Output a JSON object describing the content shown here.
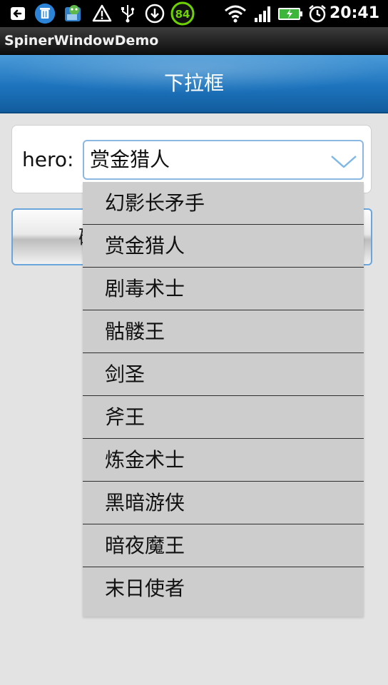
{
  "status_bar": {
    "time": "20:41",
    "battery_badge": "84",
    "icons": [
      "back-arrow-icon",
      "trash-icon",
      "app-icon",
      "warning-icon",
      "usb-icon",
      "download-icon",
      "badge-84-icon",
      "wifi-icon",
      "signal-icon",
      "battery-icon",
      "alarm-icon"
    ]
  },
  "app": {
    "title": "SpinerWindowDemo"
  },
  "header": {
    "title": "下拉框"
  },
  "form": {
    "hero_label": "hero:",
    "selected_value": "赏金猎人"
  },
  "confirm_button": {
    "label": "硊"
  },
  "dropdown": {
    "items": [
      {
        "label": "幻影长矛手"
      },
      {
        "label": "赏金猎人"
      },
      {
        "label": "剧毒术士"
      },
      {
        "label": "骷髅王"
      },
      {
        "label": "剑圣"
      },
      {
        "label": "斧王"
      },
      {
        "label": "炼金术士"
      },
      {
        "label": "黑暗游侠"
      },
      {
        "label": "暗夜魔王"
      },
      {
        "label": "末日使者"
      }
    ]
  },
  "colors": {
    "header_blue": "#1d74bd",
    "spinner_border": "#8ab8e2",
    "dropdown_bg": "#cdcdcd",
    "badge_green": "#6fd200"
  }
}
